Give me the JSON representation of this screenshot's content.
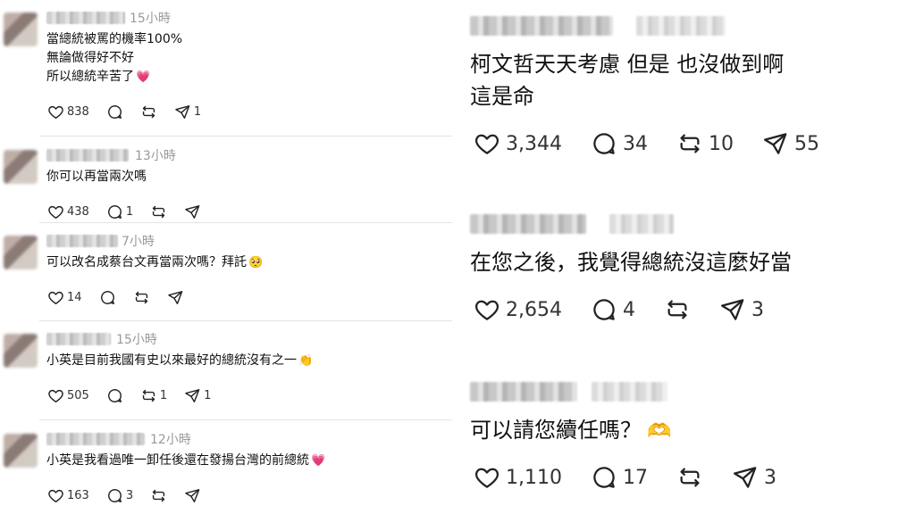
{
  "left_comments": [
    {
      "time": "15小時",
      "lines": [
        "當總統被罵的機率100%",
        "無論做得好不好",
        "所以總統辛苦了"
      ],
      "trailing_emoji": "💗",
      "likes": "838",
      "replies": "",
      "reposts": "",
      "shares": "1"
    },
    {
      "time": "13小時",
      "lines": [
        "你可以再當兩次嗎"
      ],
      "trailing_emoji": "",
      "likes": "438",
      "replies": "1",
      "reposts": "",
      "shares": ""
    },
    {
      "time": "7小時",
      "lines": [
        "可以改名成蔡台文再當兩次嗎？拜託"
      ],
      "trailing_emoji": "🥺",
      "likes": "14",
      "replies": "",
      "reposts": "",
      "shares": ""
    },
    {
      "time": "15小時",
      "lines": [
        "小英是目前我國有史以來最好的總統沒有之一"
      ],
      "trailing_emoji": "👏",
      "likes": "505",
      "replies": "",
      "reposts": "1",
      "shares": "1"
    },
    {
      "time": "12小時",
      "lines": [
        "小英是我看過唯一卸任後還在發揚台灣的前總統"
      ],
      "trailing_emoji": "💗",
      "likes": "163",
      "replies": "3",
      "reposts": "",
      "shares": ""
    }
  ],
  "right_comments": [
    {
      "lines": [
        "柯文哲天天考慮 但是 也沒做到啊",
        "這是命"
      ],
      "trailing_emoji": "",
      "likes": "3,344",
      "replies": "34",
      "reposts": "10",
      "shares": "55"
    },
    {
      "lines": [
        "在您之後，我覺得總統沒這麼好當"
      ],
      "trailing_emoji": "",
      "likes": "2,654",
      "replies": "4",
      "reposts": "",
      "shares": "3"
    },
    {
      "lines": [
        "可以請您續任嗎？"
      ],
      "trailing_emoji": "🫶",
      "likes": "1,110",
      "replies": "17",
      "reposts": "",
      "shares": "3"
    }
  ],
  "icons": {
    "like": "heart-icon",
    "reply": "comment-bubble-icon",
    "repost": "repost-arrows-icon",
    "share": "send-paper-plane-icon"
  },
  "colors": {
    "text": "#111111",
    "muted": "#999999",
    "heart_emoji": "#e0245e"
  }
}
